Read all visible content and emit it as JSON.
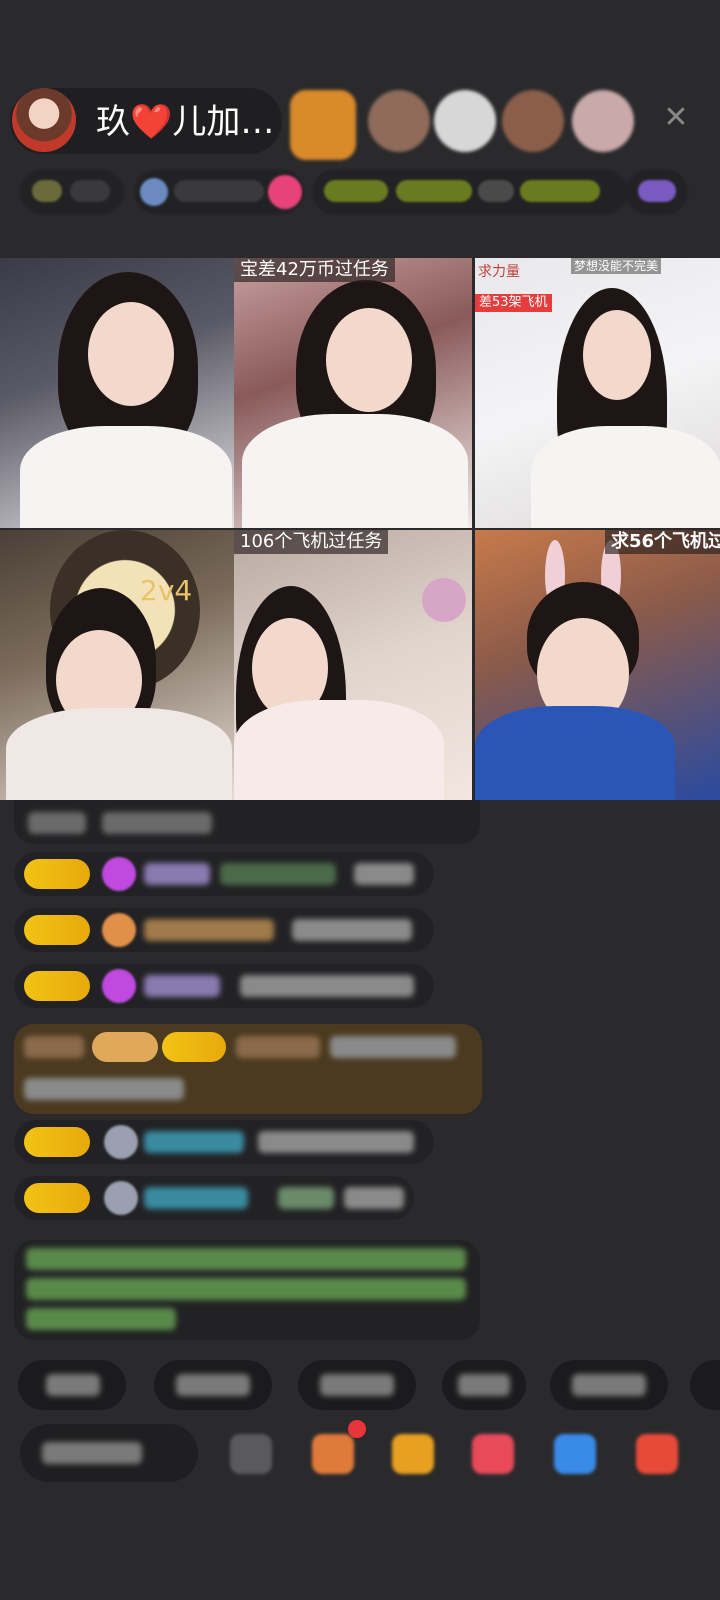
{
  "host": {
    "name_prefix": "玖",
    "heart": "❤️",
    "name_suffix": "儿加…"
  },
  "icons": {
    "close": "close-icon",
    "heart": "heart-icon"
  },
  "close_symbol": "✕",
  "video_grid": {
    "tiles": [
      {
        "caption": ""
      },
      {
        "caption": "宝差42万币过任务"
      },
      {
        "caption_top": "梦想没能不完美",
        "caption_side": "求力量",
        "red_tag": "差53架飞机"
      },
      {
        "score": "2v4"
      },
      {
        "caption": "106个飞机过任务"
      },
      {
        "caption": "求56个飞机过"
      }
    ]
  },
  "colors": {
    "background": "#2a2a2c",
    "level_badge": "#f2c315",
    "gift_bubble": "#4b3a20",
    "accent_red": "#e43d3d"
  }
}
